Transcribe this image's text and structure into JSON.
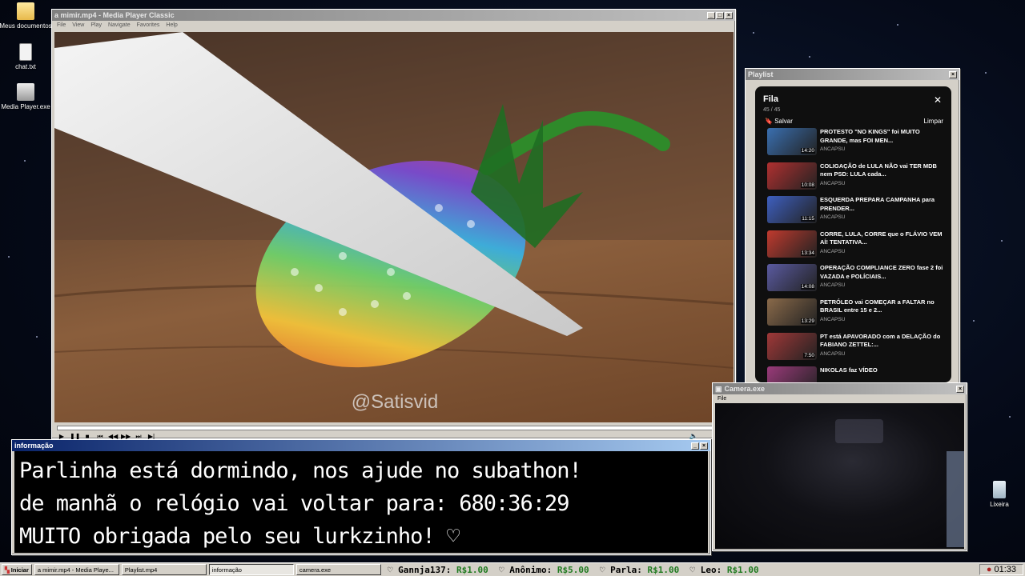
{
  "desktop": {
    "icons": [
      {
        "label": "Meus documentos",
        "icon": "folder-icon"
      },
      {
        "label": "chat.txt",
        "icon": "text-file-icon"
      },
      {
        "label": "Media Player.exe",
        "icon": "media-player-icon"
      },
      {
        "label": "Lixeira",
        "icon": "recycle-bin-icon"
      }
    ]
  },
  "player": {
    "title": "a mimir.mp4 - Media Player Classic",
    "menu": [
      "File",
      "View",
      "Play",
      "Navigate",
      "Favorites",
      "Help"
    ],
    "watermark": "@Satisvid"
  },
  "playlist": {
    "window_title": "Playlist",
    "header": "Fila",
    "count": "45 / 45",
    "save_label": "Salvar",
    "clear_label": "Limpar",
    "items": [
      {
        "title": "PROTESTO \"NO KINGS\" foi MUITO GRANDE, mas FOI MEN...",
        "channel": "ANCAPSU",
        "duration": "14:20",
        "color": "#3a6fb0"
      },
      {
        "title": "COLIGAÇÃO de LULA NÃO vai TER MDB nem PSD: LULA cada...",
        "channel": "ANCAPSU",
        "duration": "10:08",
        "color": "#b03030"
      },
      {
        "title": "ESQUERDA PREPARA CAMPANHA para PRENDER...",
        "channel": "ANCAPSU",
        "duration": "11:15",
        "color": "#3e5fbf"
      },
      {
        "title": "CORRE, LULA, CORRE que o FLÁVIO VEM AÍ! TENTATIVA...",
        "channel": "ANCAPSU",
        "duration": "13:34",
        "color": "#c03a2e"
      },
      {
        "title": "OPERAÇÃO COMPLIANCE ZERO fase 2 foi VAZADA e POLÍCIAIS...",
        "channel": "ANCAPSU",
        "duration": "14:08",
        "color": "#5a5aa0"
      },
      {
        "title": "PETRÓLEO vai COMEÇAR a FALTAR no BRASIL entre 15 e 2...",
        "channel": "ANCAPSU",
        "duration": "13:29",
        "color": "#8a6a4a"
      },
      {
        "title": "PT está APAVORADO com a DELAÇÃO do FABIANO ZETTEL:...",
        "channel": "ANCAPSU",
        "duration": "7:50",
        "color": "#a03838"
      },
      {
        "title": "NIKOLAS faz VÍDEO",
        "channel": "",
        "duration": "",
        "color": "#9a3a7a"
      }
    ]
  },
  "info": {
    "title": "informação",
    "line1": "Parlinha está dormindo, nos ajude no subathon!",
    "line2": "de manhã o relógio vai voltar para:  680:36:29",
    "line3": "MUITO obrigada pelo seu lurkzinho! ♡"
  },
  "camera": {
    "title": "Camera.exe",
    "menu_file": "File"
  },
  "taskbar": {
    "start": "Iniciar",
    "buttons": [
      "a mimir.mp4 - Media Playe...",
      "Playlist.mp4",
      "informação",
      "camera.exe"
    ],
    "ticker": [
      {
        "name": "Gannja137:",
        "amount": "R$1.00"
      },
      {
        "name": "Anônimo:",
        "amount": "R$5.00"
      },
      {
        "name": "Parla:",
        "amount": "R$1.00"
      },
      {
        "name": "Leo:",
        "amount": "R$1.00"
      }
    ],
    "clock": "01:33"
  },
  "colors": {
    "title_active": "#0a246a",
    "ticker_amount": "#1f7a1f"
  }
}
